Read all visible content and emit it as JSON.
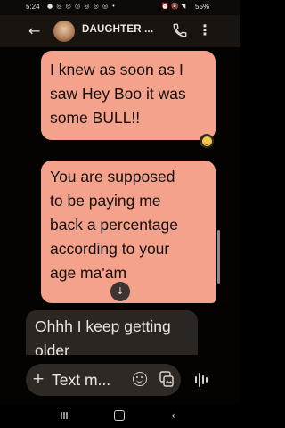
{
  "status_bar": {
    "time": "5:24",
    "notification_icons": "● ◎ ◎ ◎ ◎ ◎ ◎ •",
    "right_icons": "⏰ 🔇 ◥",
    "battery": "55%"
  },
  "header": {
    "contact_name": "DAUGHTER ...",
    "back_icon": "arrow-left",
    "call_icon": "phone",
    "more_icon": "vertical-dots"
  },
  "messages": [
    {
      "direction": "outgoing",
      "text": "I knew as soon as I saw Hey Boo it was some BULL!!",
      "reaction": "grinning-face"
    },
    {
      "direction": "outgoing",
      "lines": [
        "You are supposed",
        "to be paying me",
        "back a percentage",
        "according to your",
        "age ma'am"
      ]
    },
    {
      "direction": "incoming",
      "text": "Ohhh I keep getting older"
    }
  ],
  "scroll_down_icon": "arrow-down",
  "compose": {
    "placeholder": "Text m...",
    "plus_icon": "plus",
    "emoji_icon": "smiley",
    "gallery_icon": "gallery",
    "voice_icon": "voice-wave"
  },
  "colors": {
    "outgoing_bubble": "#f4a28b",
    "incoming_bubble": "#2b2622",
    "background": "#050302"
  }
}
